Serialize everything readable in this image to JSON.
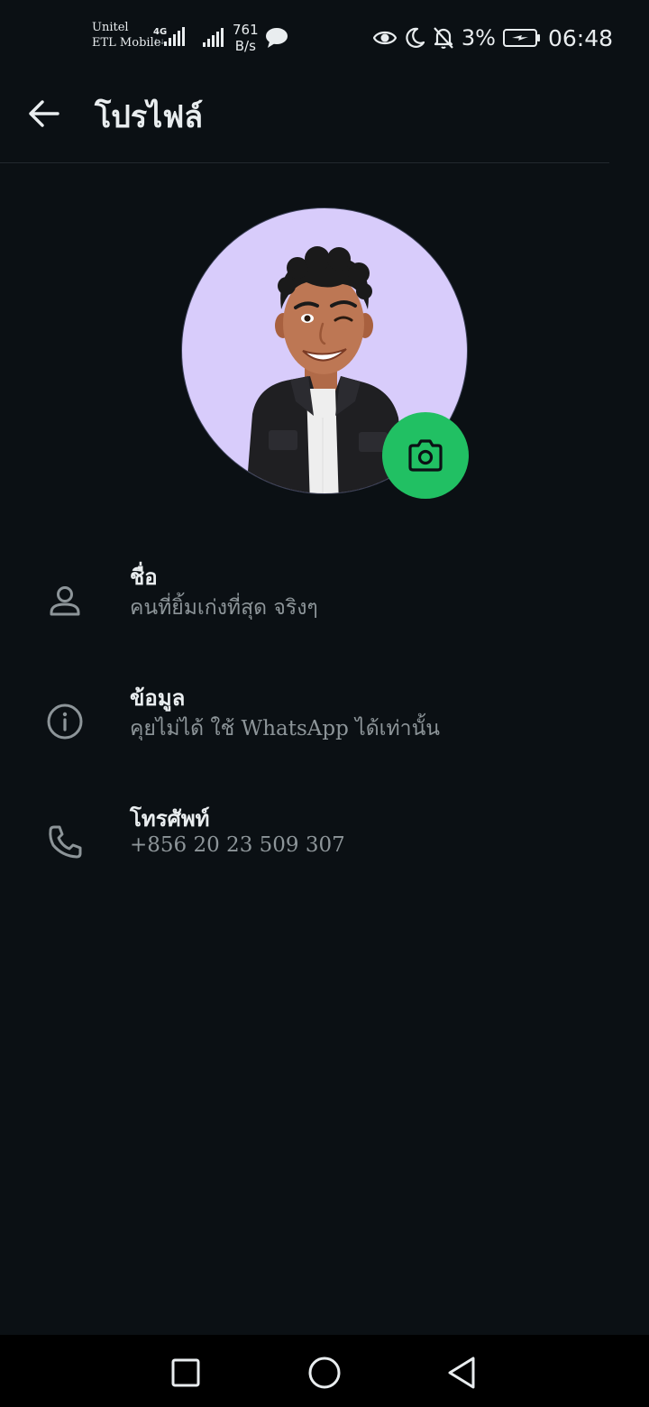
{
  "status_bar": {
    "carrier_line1": "Unitel",
    "carrier_line2": "ETL Mobile",
    "network_type": "4G",
    "net_speed_value": "761",
    "net_speed_unit": "B/s",
    "battery_percent": "3%",
    "time": "06:48"
  },
  "app_bar": {
    "title": "โปรไฟล์"
  },
  "profile": {
    "rows": [
      {
        "label": "ชื่อ",
        "value": "คนที่ยิ้มเก่งที่สุด จริงๆ",
        "icon": "person-icon"
      },
      {
        "label": "ข้อมูล",
        "value": "คุยไม่ได้ ใช้ WhatsApp ได้เท่านั้น",
        "icon": "info-icon"
      },
      {
        "label": "โทรศัพท์",
        "value": "+856 20 23 509 307",
        "icon": "phone-icon"
      }
    ]
  },
  "colors": {
    "background": "#0b1014",
    "accent": "#21c063",
    "avatar_background": "#d8ccfb",
    "secondary_text": "#8d9599"
  },
  "icons": {
    "back": "arrow-left-icon",
    "camera": "camera-icon",
    "nav_recents": "square-icon",
    "nav_home": "circle-icon",
    "nav_back": "triangle-back-icon"
  }
}
